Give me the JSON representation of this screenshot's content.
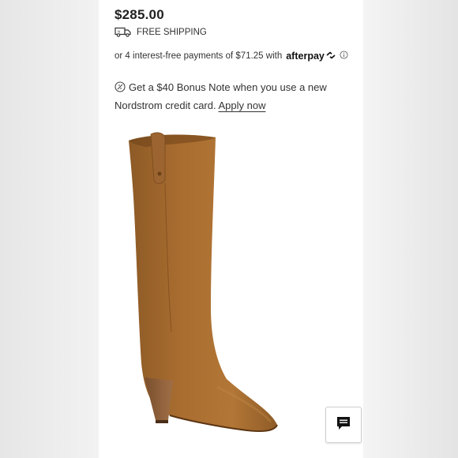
{
  "product": {
    "price": "$285.00"
  },
  "shipping": {
    "label": "FREE SHIPPING",
    "icon": "truck-icon"
  },
  "payment": {
    "text": "or 4 interest-free payments of $71.25 with",
    "provider": "afterpay",
    "icon": "afterpay-arrows-icon",
    "info_icon": "info-icon"
  },
  "promo": {
    "text": "Get a $40 Bonus Note when you use a new Nordstrom credit card.",
    "link": "Apply now",
    "icon": "note-badge-icon"
  },
  "chat": {
    "icon": "chat-icon"
  },
  "colors": {
    "boot": "#a56a2e",
    "boot_dark": "#7e4c1d",
    "heel": "#8a5a35"
  }
}
